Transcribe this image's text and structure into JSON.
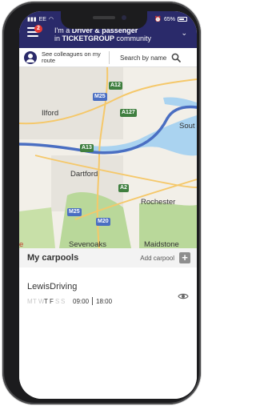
{
  "status": {
    "carrier": "EE",
    "battery": "65%"
  },
  "header": {
    "badge_count": "2",
    "role_prefix": "I'm a ",
    "role_value": "Driver & passenger",
    "community_prefix": "in ",
    "community_name": "TICKETGROUP",
    "community_suffix": " community"
  },
  "search_row": {
    "colleagues_label": "See colleagues on my route",
    "search_label": "Search by name"
  },
  "map": {
    "places": [
      "Ilford",
      "Dartford",
      "Rochester",
      "Sevenoaks",
      "Maidstone",
      "Sout"
    ],
    "roads": [
      "A12",
      "M25",
      "A127",
      "A13",
      "A2",
      "M25",
      "M20"
    ],
    "edge_letter": "e"
  },
  "carpools": {
    "title": "My carpools",
    "add_label": "Add carpool",
    "add_symbol": "+",
    "items": [
      {
        "name": "LewisDriving",
        "days": [
          {
            "letter": "M",
            "active": false
          },
          {
            "letter": "T",
            "active": false
          },
          {
            "letter": "W",
            "active": false
          },
          {
            "letter": "T",
            "active": true
          },
          {
            "letter": "F",
            "active": true
          },
          {
            "letter": "S",
            "active": false
          },
          {
            "letter": "S",
            "active": false
          }
        ],
        "outbound_time": "09:00",
        "return_time": "18:00"
      }
    ]
  },
  "colors": {
    "header_bg": "#2a2a6a",
    "badge": "#e53935",
    "route": "#4a6ec2",
    "water": "#aad3f0",
    "park": "#b9d89a"
  }
}
